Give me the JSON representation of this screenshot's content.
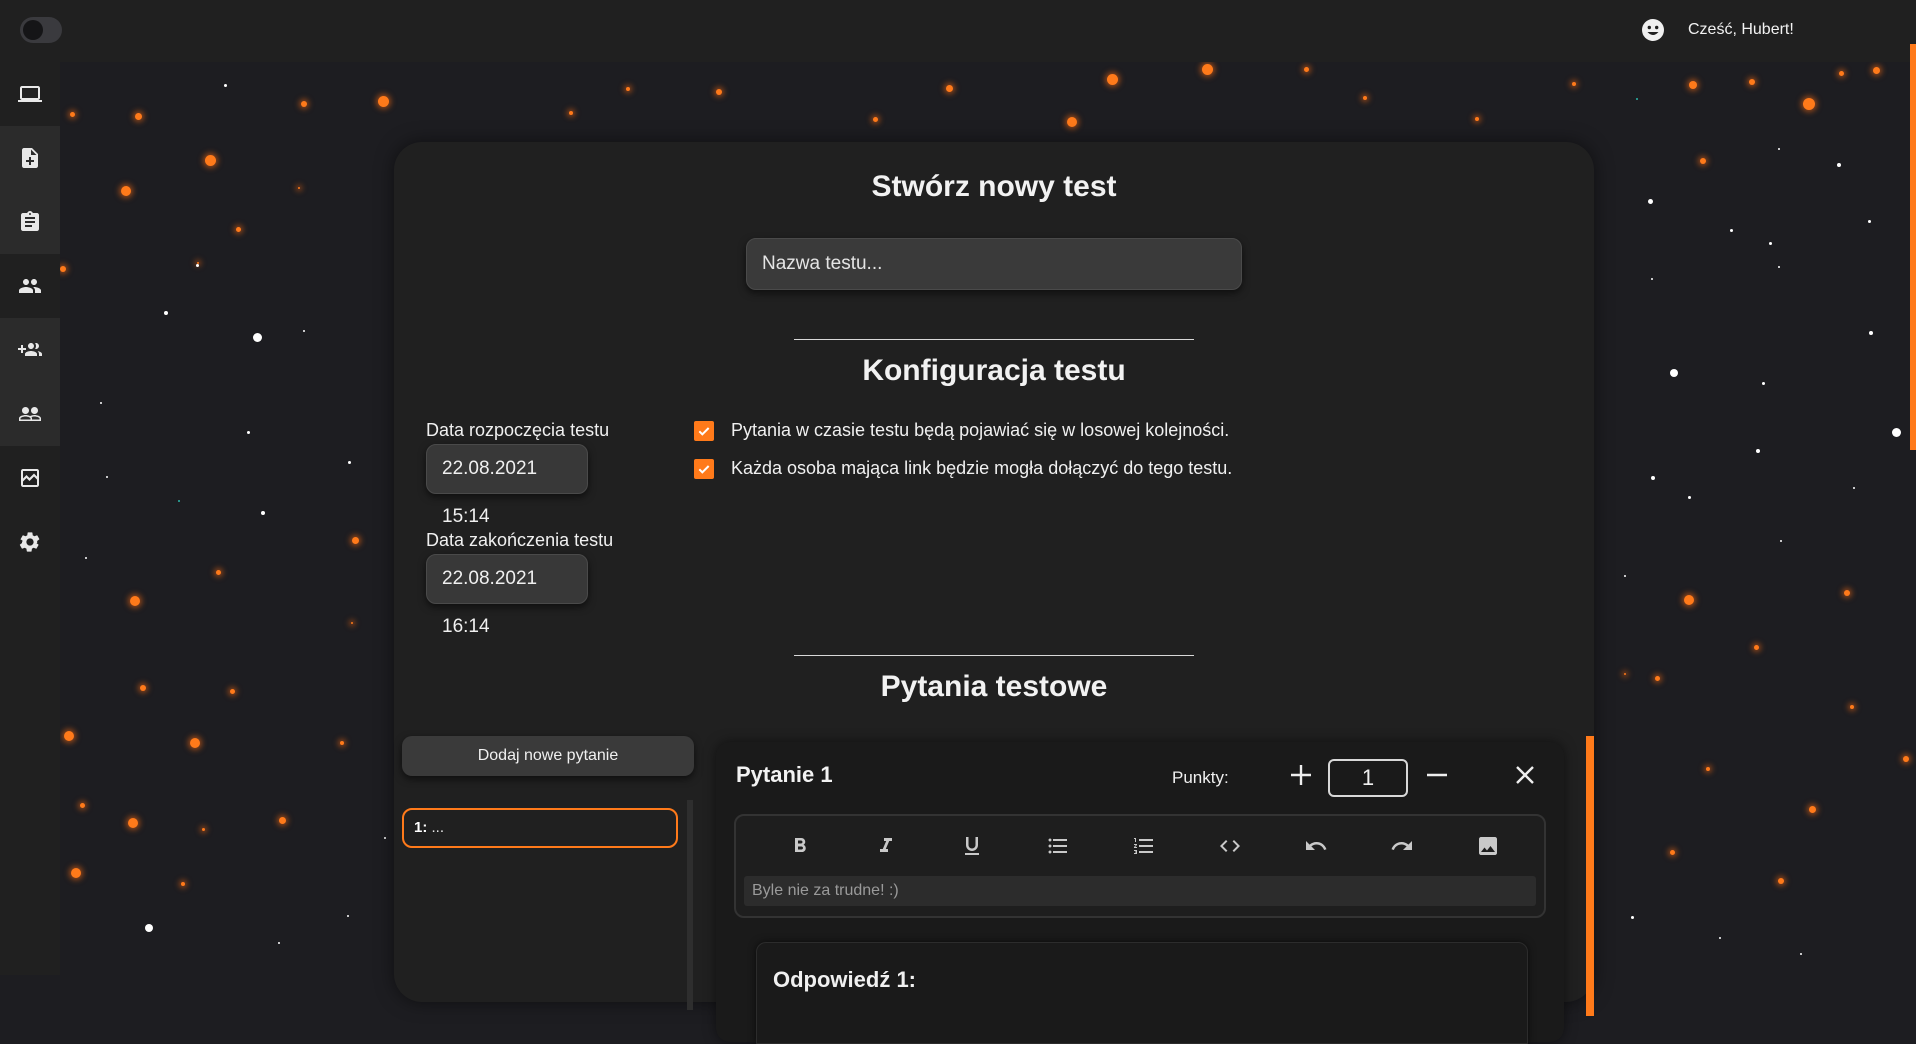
{
  "topbar": {
    "greeting": "Cześć, Hubert!"
  },
  "sidebar": {
    "items": [
      {
        "icon": "laptop-icon"
      },
      {
        "icon": "add-document-icon"
      },
      {
        "icon": "clipboard-icon"
      },
      {
        "icon": "people-icon"
      },
      {
        "icon": "group-add-icon"
      },
      {
        "icon": "people-outline-icon"
      },
      {
        "icon": "analytics-icon"
      },
      {
        "icon": "gear-icon"
      }
    ]
  },
  "form": {
    "title": "Stwórz nowy test",
    "name_placeholder": "Nazwa testu...",
    "config_title": "Konfiguracja testu",
    "start_label": "Data rozpoczęcia testu",
    "start_value": "22.08.2021 15:14",
    "end_label": "Data zakończenia testu",
    "end_value": "22.08.2021 16:14",
    "options": [
      {
        "label": "Pytania w czasie testu będą pojawiać się w losowej kolejności.",
        "checked": true
      },
      {
        "label": "Każda osoba mająca link będzie mogła dołączyć do tego testu.",
        "checked": true
      }
    ],
    "questions_title": "Pytania testowe",
    "add_question": "Dodaj nowe pytanie",
    "question_list": [
      {
        "num": "1:",
        "text": "..."
      }
    ]
  },
  "question": {
    "title": "Pytanie 1",
    "points_label": "Punkty:",
    "points_value": "1",
    "editor_text": "Byle nie za trudne! :)",
    "toolbar": [
      "bold-icon",
      "italic-icon",
      "underline-icon",
      "bullet-list-icon",
      "numbered-list-icon",
      "code-icon",
      "undo-icon",
      "redo-icon",
      "image-icon"
    ],
    "answer_title": "Odpowiedź 1:"
  },
  "colors": {
    "accent": "#ff7a1a",
    "background": "#1d1d21",
    "panel": "#202020"
  }
}
